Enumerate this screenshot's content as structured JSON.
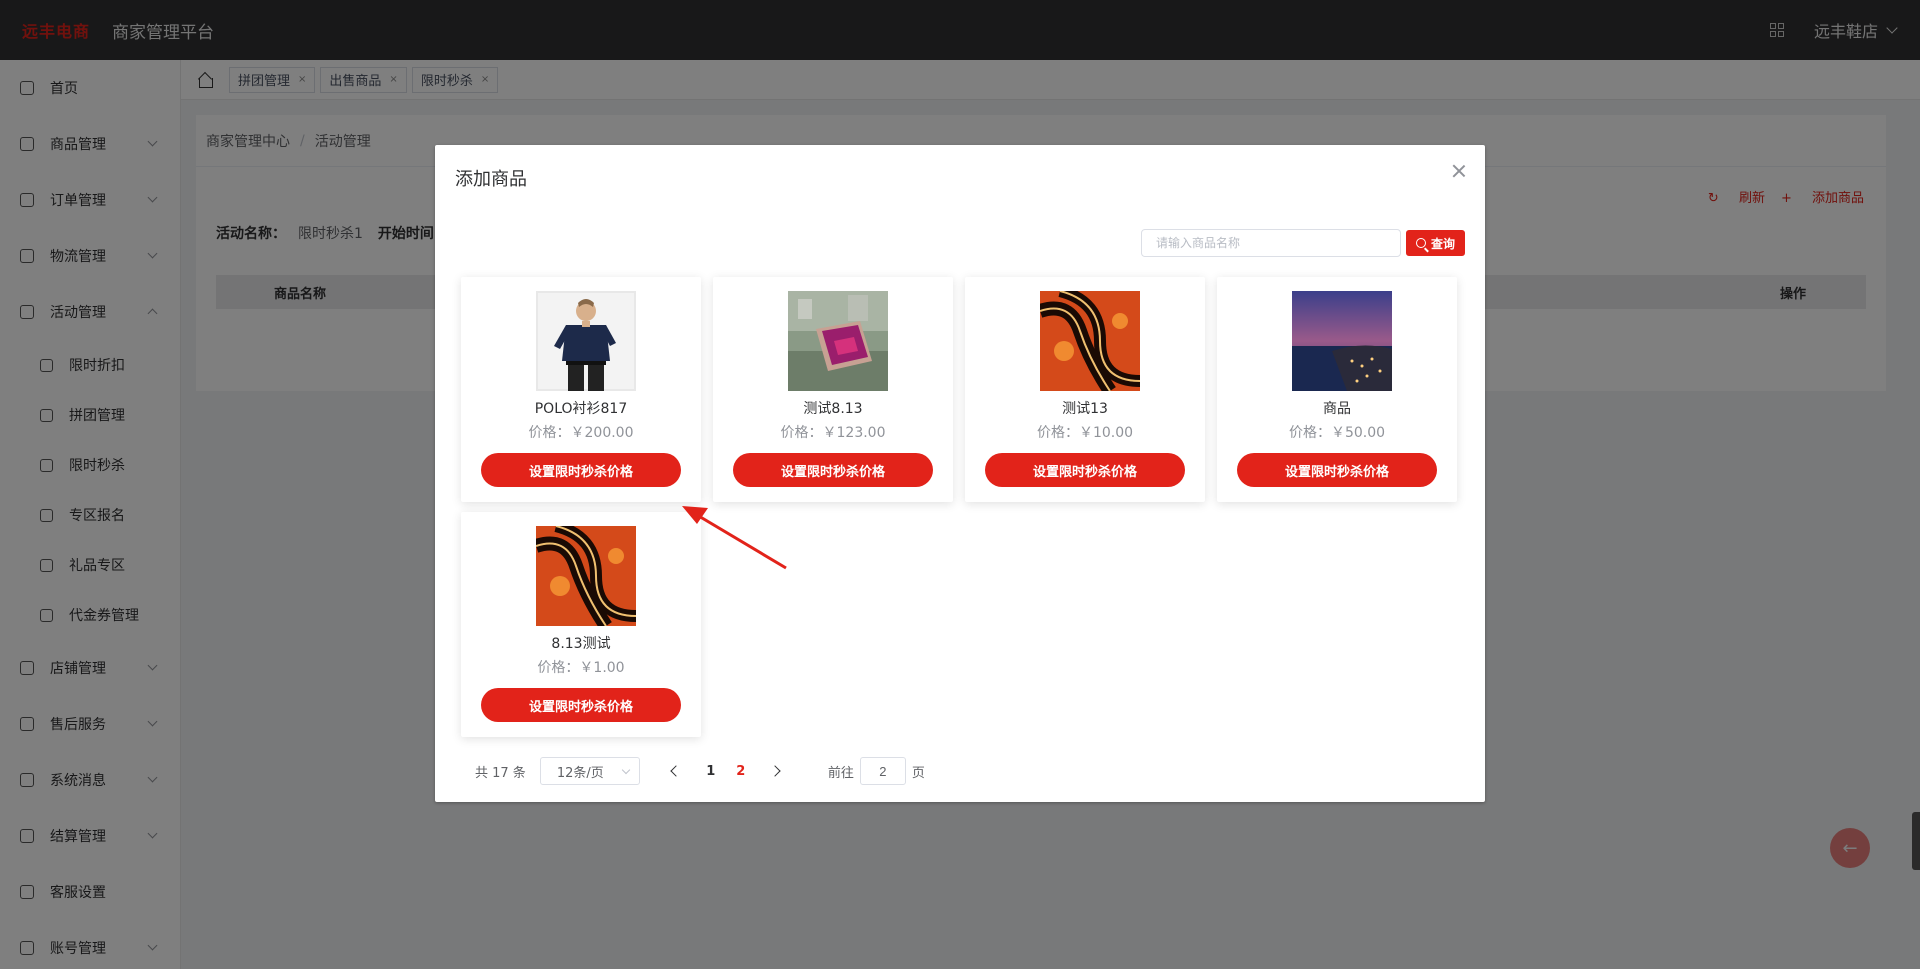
{
  "header": {
    "logo_text": "远丰电商",
    "platform_title": "商家管理平台",
    "shop_name": "远丰鞋店"
  },
  "sidebar": {
    "items": [
      {
        "label": "首页",
        "icon": "home-icon"
      },
      {
        "label": "商品管理",
        "icon": "goods-icon"
      },
      {
        "label": "订单管理",
        "icon": "order-icon"
      },
      {
        "label": "物流管理",
        "icon": "truck-icon"
      },
      {
        "label": "活动管理",
        "icon": "tag-icon",
        "expanded": true
      },
      {
        "label": "店铺管理",
        "icon": "store-icon"
      },
      {
        "label": "售后服务",
        "icon": "service-icon"
      },
      {
        "label": "系统消息",
        "icon": "message-icon"
      },
      {
        "label": "结算管理",
        "icon": "settle-icon"
      },
      {
        "label": "客服设置",
        "icon": "cs-icon"
      },
      {
        "label": "账号管理",
        "icon": "account-icon"
      }
    ],
    "sub_items": [
      {
        "label": "限时折扣",
        "icon": "discount-icon"
      },
      {
        "label": "拼团管理",
        "icon": "group-icon"
      },
      {
        "label": "限时秒杀",
        "icon": "clock-icon"
      },
      {
        "label": "专区报名",
        "icon": "signup-icon"
      },
      {
        "label": "礼品专区",
        "icon": "gift-icon"
      },
      {
        "label": "代金券管理",
        "icon": "coupon-icon"
      }
    ]
  },
  "tabs": [
    "拼团管理",
    "出售商品",
    "限时秒杀"
  ],
  "tab_close": "×",
  "breadcrumb": [
    "商家管理中心",
    "活动管理"
  ],
  "page": {
    "refresh_label": "刷新",
    "add_label": "添加商品",
    "activity_name_label": "活动名称：",
    "activity_name_value": "限时秒杀1",
    "start_time_label": "开始时间",
    "col_name": "商品名称",
    "col_ops": "操作"
  },
  "dialog": {
    "title": "添加商品",
    "search_placeholder": "请输入商品名称",
    "search_button": "查询",
    "products": [
      {
        "name": "POLO衬衫817",
        "price": "价格：￥200.00",
        "button": "设置限时秒杀价格",
        "image": "shirt-model"
      },
      {
        "name": "测试8.13",
        "price": "价格：￥123.00",
        "button": "设置限时秒杀价格",
        "image": "phone-in-hand"
      },
      {
        "name": "测试13",
        "price": "价格：￥10.00",
        "button": "设置限时秒杀价格",
        "image": "abstract-orange"
      },
      {
        "name": "商品",
        "price": "价格：￥50.00",
        "button": "设置限时秒杀价格",
        "image": "night-coast"
      },
      {
        "name": "8.13测试",
        "price": "价格：￥1.00",
        "button": "设置限时秒杀价格",
        "image": "abstract-orange"
      }
    ],
    "pager": {
      "total": "共 17 条",
      "page_size": "12条/页",
      "pages": [
        "1",
        "2"
      ],
      "current_page": "2",
      "goto_label": "前往",
      "goto_value": "2",
      "page_suffix": "页"
    }
  },
  "colors": {
    "accent": "#e2231a",
    "header_bg": "#303133"
  }
}
